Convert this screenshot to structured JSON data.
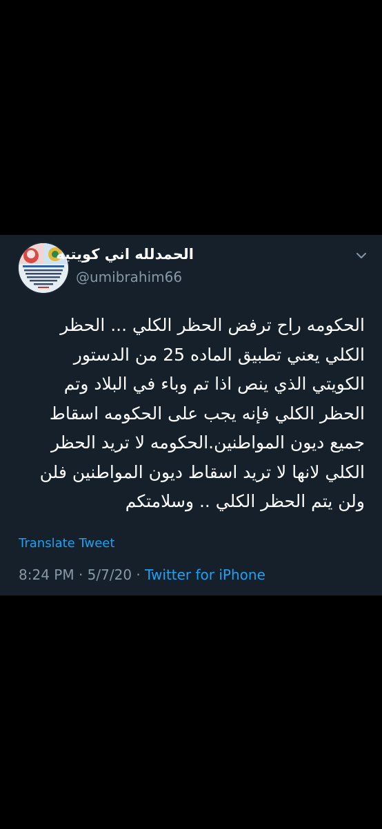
{
  "tweet": {
    "display_name": "الحمدلله اني كويتيه",
    "handle": "@umibrahim66",
    "body_lines": [
      "الحكومه راح ترفض الحظر الكلي ... الحظر",
      "الكلي يعني تطبيق الماده  25 من الدستور",
      "الكويتي الذي ينص اذا تم وباء في البلاد وتم",
      "الحظر الكلي فإنه يجب على الحكومه اسقاط",
      "جميع ديون المواطنين.الحكومه لا تريد الحظر",
      "الكلي لانها لا تريد اسقاط ديون المواطنين فلن",
      "ولن يتم الحظر الكلي .. وسلامتكم"
    ],
    "translate_label": "Translate Tweet",
    "time": "8:24 PM",
    "date": "5/7/20",
    "separator": " · ",
    "source": "Twitter for iPhone"
  },
  "icons": {
    "menu": "chevron-down-icon",
    "avatar": "profile-avatar"
  },
  "colors": {
    "page_background": "#000000",
    "card_background": "#15202b",
    "primary_text": "#ffffff",
    "secondary_text": "#8899a6",
    "accent": "#1da1f2"
  }
}
